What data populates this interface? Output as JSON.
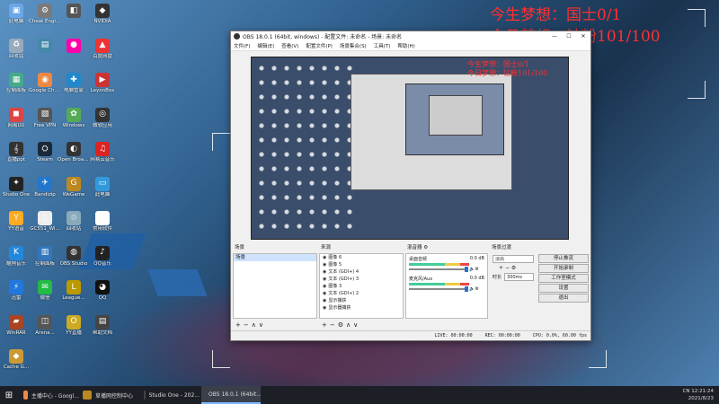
{
  "overlay": {
    "line1": "今生梦想：国士0/1",
    "line2": "今日梦想：钻粉101/100"
  },
  "desktop_icons": [
    {
      "label": "此电脑",
      "color": "#6aa7e8",
      "glyph": "▣"
    },
    {
      "label": "Cheat Engine",
      "color": "#7a7a7a",
      "glyph": "⚙"
    },
    {
      "label": "",
      "color": "#555",
      "glyph": "◧"
    },
    {
      "label": "NVIDIA",
      "color": "#333",
      "glyph": "◆"
    },
    {
      "label": "回收站",
      "color": "#9ab",
      "glyph": "♻"
    },
    {
      "label": "",
      "color": "#48a",
      "glyph": "▤"
    },
    {
      "label": "",
      "color": "#f0a",
      "glyph": "●"
    },
    {
      "label": "百度网盘",
      "color": "#e33",
      "glyph": "▲"
    },
    {
      "label": "控制面板",
      "color": "#4a8",
      "glyph": "▦"
    },
    {
      "label": "Google Chrome",
      "color": "#e84",
      "glyph": "◉"
    },
    {
      "label": "电脑管家",
      "color": "#28c",
      "glyph": "✚"
    },
    {
      "label": "LeyonBox",
      "color": "#c33",
      "glyph": "▶"
    },
    {
      "label": "网易UU",
      "color": "#d44",
      "glyph": "◼"
    },
    {
      "label": "Free VPN",
      "color": "#555",
      "glyph": "▧"
    },
    {
      "label": "Windows",
      "color": "#5a5",
      "glyph": "✿"
    },
    {
      "label": "微软应用",
      "color": "#333",
      "glyph": "◎"
    },
    {
      "label": "直播ppt",
      "color": "#333",
      "glyph": "𝄞"
    },
    {
      "label": "Steam",
      "color": "#1b2838",
      "glyph": "⛭"
    },
    {
      "label": "Open Broadcast...",
      "color": "#333",
      "glyph": "◐"
    },
    {
      "label": "网易云音乐",
      "color": "#d22",
      "glyph": "♫"
    },
    {
      "label": "Studio One",
      "color": "#222",
      "glyph": "✦"
    },
    {
      "label": "Bandizip",
      "color": "#27c",
      "glyph": "✈"
    },
    {
      "label": "WeGame",
      "color": "#b82",
      "glyph": "G"
    },
    {
      "label": "此电脑",
      "color": "#39d",
      "glyph": "▭"
    },
    {
      "label": "YY语音",
      "color": "#fa2",
      "glyph": "Y"
    },
    {
      "label": "GC551_Wi...",
      "color": "#eee",
      "glyph": "▯"
    },
    {
      "label": "回收站",
      "color": "#8ab",
      "glyph": "♲"
    },
    {
      "label": "常用软件",
      "color": "#fff",
      "glyph": "▯"
    },
    {
      "label": "酷狗音乐",
      "color": "#28d",
      "glyph": "K"
    },
    {
      "label": "控制面板",
      "color": "#37b",
      "glyph": "▥"
    },
    {
      "label": "OBS Studio",
      "color": "#333",
      "glyph": "◍"
    },
    {
      "label": "QQ音乐",
      "color": "#222",
      "glyph": "♪"
    },
    {
      "label": "迅雷",
      "color": "#27d",
      "glyph": "⚡"
    },
    {
      "label": "微信",
      "color": "#2b4",
      "glyph": "✉"
    },
    {
      "label": "League...",
      "color": "#b90",
      "glyph": "L"
    },
    {
      "label": "QQ",
      "color": "#111",
      "glyph": "◕"
    },
    {
      "label": "WinRAR",
      "color": "#a42",
      "glyph": "▰"
    },
    {
      "label": "Arena...",
      "color": "#555",
      "glyph": "◫"
    },
    {
      "label": "YY直播",
      "color": "#ca2",
      "glyph": "O"
    },
    {
      "label": "帮助文档",
      "color": "#444",
      "glyph": "▤"
    },
    {
      "label": "Cache G...",
      "color": "#c93",
      "glyph": "◆"
    }
  ],
  "obs": {
    "title": "OBS 18.0.1 (64bit, windows) - 配置文件: 未命名 - 场景: 未命名",
    "menu": [
      "文件(F)",
      "编辑(E)",
      "查看(V)",
      "配置文件(P)",
      "场景集合(S)",
      "工具(T)",
      "帮助(H)"
    ],
    "preview_overlay_1": "今生梦想：国士0/1",
    "preview_overlay_2": "今日梦想：钻粉101/100",
    "scenes": {
      "header": "场景",
      "items": [
        "场景"
      ]
    },
    "sources": {
      "header": "来源",
      "items": [
        "图像 6",
        "图像 5",
        "文本 (GDI+) 4",
        "文本 (GDI+) 3",
        "图像 3",
        "文本 (GDI+) 2",
        "显示捕获",
        "显示器捕获"
      ]
    },
    "mixer": {
      "header": "混音器",
      "channels": [
        {
          "name": "桌面音频",
          "db": "0.0 dB"
        },
        {
          "name": "麦克风/Aux",
          "db": "0.0 dB"
        }
      ]
    },
    "transitions": {
      "header": "场景过渡",
      "type": "淡出",
      "duration_label": "时长",
      "duration": "300ms"
    },
    "controls": {
      "stop_stream": "停止推流",
      "start_record": "开始录制",
      "studio_mode": "工作室模式",
      "settings": "设置",
      "exit": "退出"
    },
    "status": {
      "live": "LIVE: 00:00:00",
      "rec": "REC: 00:00:00",
      "cpu": "CPU: 0.0%, 60.00 fps"
    }
  },
  "taskbar": {
    "items": [
      {
        "label": "主播中心 - Googl...",
        "color": "#e84"
      },
      {
        "label": "草播网控制中心",
        "color": "#b82"
      },
      {
        "label": "Studio One - 202...",
        "color": "#444"
      },
      {
        "label": "OBS 18.0.1 (64bit...",
        "color": "#666"
      }
    ],
    "time": "12:21:24",
    "date": "2021/8/23",
    "tray_text": "CN"
  }
}
